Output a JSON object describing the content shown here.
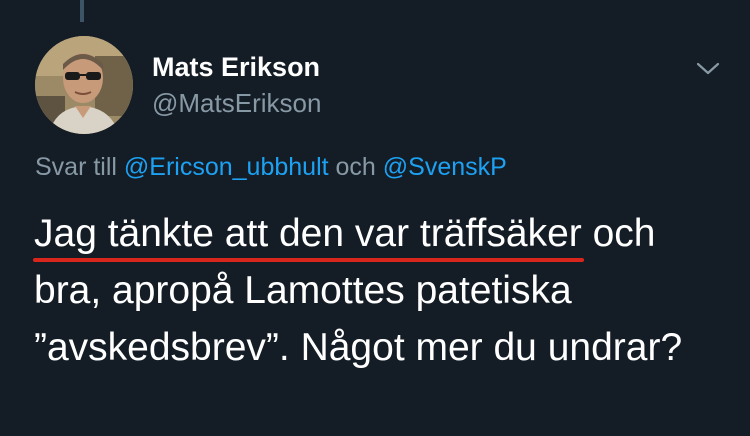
{
  "user": {
    "display_name": "Mats Erikson",
    "handle": "@MatsErikson",
    "avatar_icon": "user-avatar-photo"
  },
  "header": {
    "menu_icon": "chevron-down-icon"
  },
  "reply": {
    "prefix": "Svar till ",
    "mention_1": "@Ericson_ubbhult",
    "joiner": " och ",
    "mention_2": "@SvenskP"
  },
  "tweet": {
    "line1_underlined": "Jag tänkte att den var träffsäker",
    "line1_rest": " och",
    "line2": "bra, apropå Lamottes patetiska",
    "line3": "”avskedsbrev”. Något mer du undrar?"
  },
  "colors": {
    "background": "#141d26",
    "text_primary": "#ffffff",
    "text_secondary": "#8899a6",
    "link": "#1da1f2",
    "annotation_underline": "#d9261c"
  }
}
